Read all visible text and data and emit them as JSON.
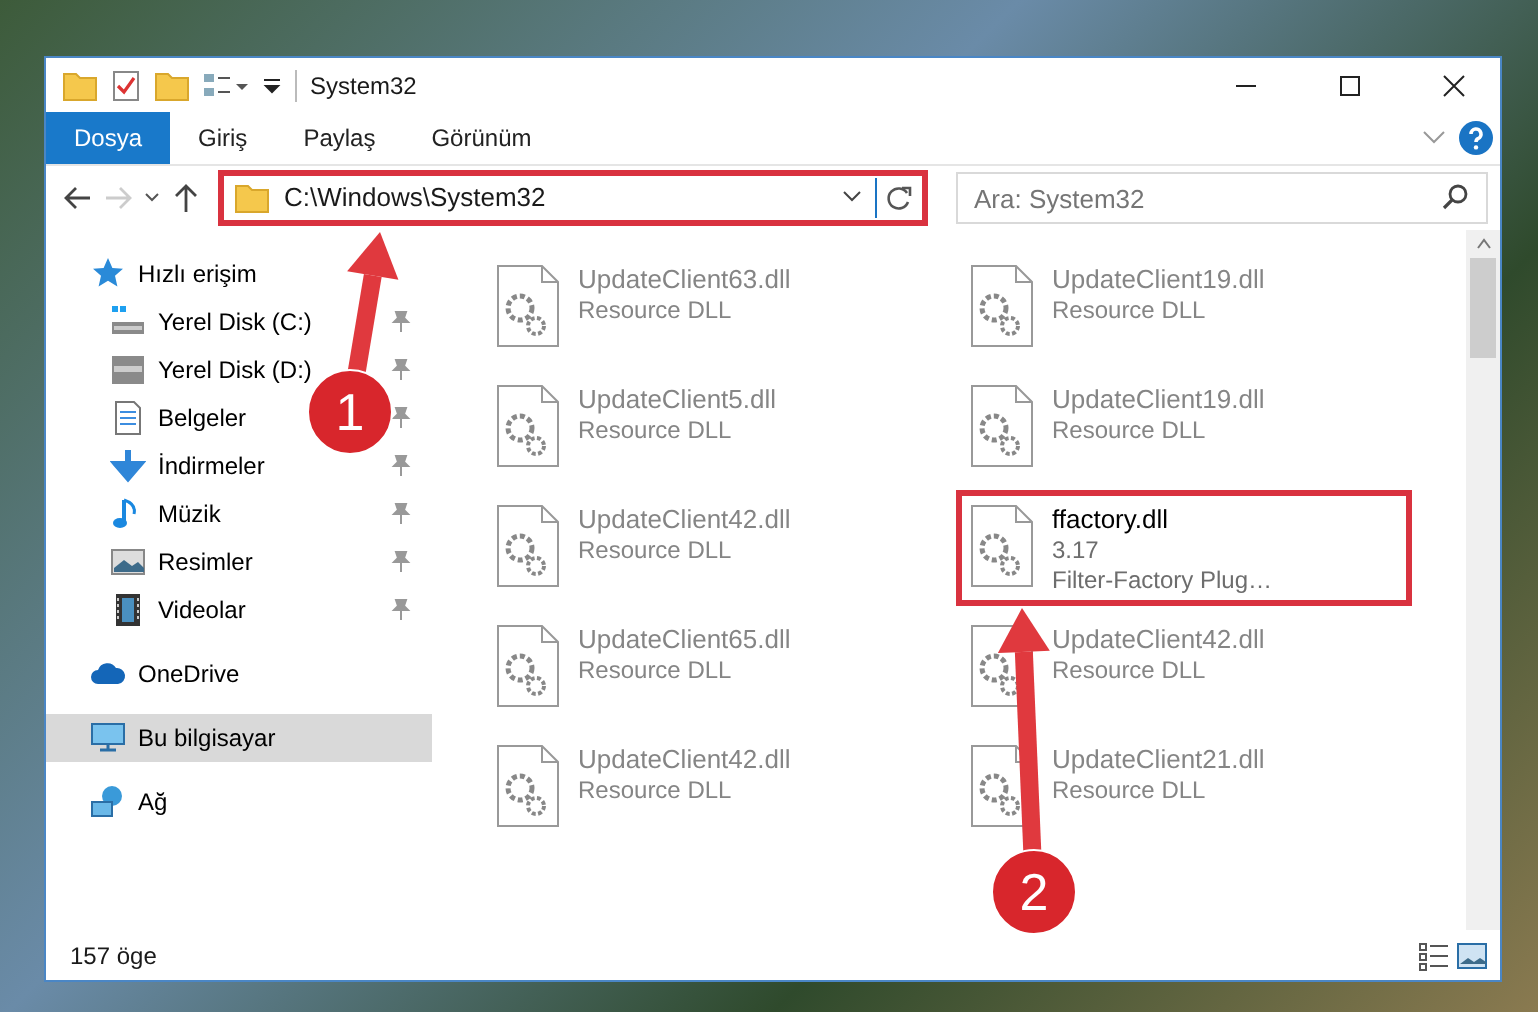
{
  "window": {
    "title": "System32"
  },
  "ribbon_tabs": [
    {
      "label": "Dosya",
      "selected": true
    },
    {
      "label": "Giriş",
      "selected": false
    },
    {
      "label": "Paylaş",
      "selected": false
    },
    {
      "label": "Görünüm",
      "selected": false
    }
  ],
  "address": {
    "path": "C:\\Windows\\System32",
    "highlighted": true,
    "annotation": "1"
  },
  "search": {
    "placeholder": "Ara: System32"
  },
  "nav": [
    {
      "label": "Hızlı erişim",
      "kind": "star",
      "selected": false,
      "children": [
        {
          "label": "Yerel Disk (C:)",
          "kind": "system-drive",
          "selected": false,
          "pinned": true
        },
        {
          "label": "Yerel Disk (D:)",
          "kind": "drive",
          "selected": false,
          "pinned": true
        },
        {
          "label": "Belgeler",
          "kind": "documents",
          "selected": false,
          "pinned": true
        },
        {
          "label": "İndirmeler",
          "kind": "download",
          "selected": false,
          "pinned": true
        },
        {
          "label": "Müzik",
          "kind": "music",
          "selected": false,
          "pinned": true
        },
        {
          "label": "Resimler",
          "kind": "pictures",
          "selected": false,
          "pinned": true
        },
        {
          "label": "Videolar",
          "kind": "videos",
          "selected": false,
          "pinned": true
        }
      ]
    },
    {
      "label": "OneDrive",
      "kind": "cloud",
      "selected": false
    },
    {
      "label": "Bu bilgisayar",
      "kind": "computer",
      "selected": true
    },
    {
      "label": "Ağ",
      "kind": "network",
      "selected": false
    }
  ],
  "files": [
    {
      "name": "UpdateClient63.dll",
      "details": [
        "Resource DLL"
      ],
      "blurred": true,
      "highlighted": false
    },
    {
      "name": "UpdateClient19.dll",
      "details": [
        "Resource DLL"
      ],
      "blurred": true,
      "highlighted": false
    },
    {
      "name": "UpdateClient5.dll",
      "details": [
        "Resource DLL"
      ],
      "blurred": true,
      "highlighted": false
    },
    {
      "name": "UpdateClient19.dll",
      "details": [
        "Resource DLL"
      ],
      "blurred": true,
      "highlighted": false
    },
    {
      "name": "UpdateClient42.dll",
      "details": [
        "Resource DLL"
      ],
      "blurred": true,
      "highlighted": false
    },
    {
      "name": "ffactory.dll",
      "details": [
        "3.17",
        "Filter-Factory Plug…"
      ],
      "blurred": false,
      "highlighted": true,
      "annotation": "2"
    },
    {
      "name": "UpdateClient65.dll",
      "details": [
        "Resource DLL"
      ],
      "blurred": true,
      "highlighted": false
    },
    {
      "name": "UpdateClient42.dll",
      "details": [
        "Resource DLL"
      ],
      "blurred": true,
      "highlighted": false
    },
    {
      "name": "UpdateClient42.dll",
      "details": [
        "Resource DLL"
      ],
      "blurred": true,
      "highlighted": false
    },
    {
      "name": "UpdateClient21.dll",
      "details": [
        "Resource DLL"
      ],
      "blurred": true,
      "highlighted": false
    }
  ],
  "status_bar": {
    "count": "157 öge"
  }
}
